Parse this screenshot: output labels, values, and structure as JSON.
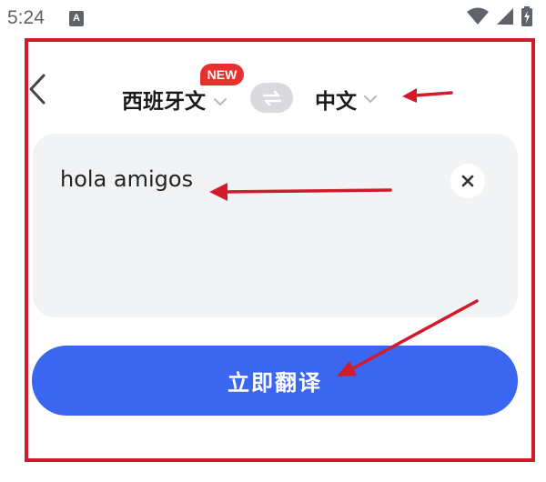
{
  "status_bar": {
    "time": "5:24",
    "app_icon_letter": "A"
  },
  "header": {
    "back_icon": "chevron-left-icon",
    "source_language": "西班牙文",
    "new_badge": "NEW",
    "swap_icon": "swap-arrows-icon",
    "target_language": "中文"
  },
  "input": {
    "text": "hola amigos",
    "clear_icon": "close-icon"
  },
  "translate_button": {
    "label": "立即翻译"
  },
  "colors": {
    "primary_button": "#3b67f0",
    "badge": "#e8312f",
    "annotation": "#d11a2a",
    "card_bg": "#f2f3f5"
  }
}
